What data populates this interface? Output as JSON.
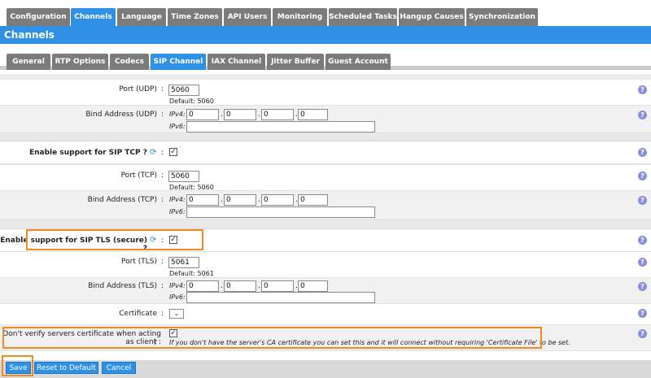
{
  "top_tabs": [
    {
      "label": "Configuration"
    },
    {
      "label": "Channels"
    },
    {
      "label": "Language"
    },
    {
      "label": "Time Zones"
    },
    {
      "label": "API Users"
    },
    {
      "label": "Monitoring"
    },
    {
      "label": "Scheduled Tasks"
    },
    {
      "label": "Hangup Causes"
    },
    {
      "label": "Synchronization"
    }
  ],
  "section_title": "Channels",
  "sub_tabs": [
    {
      "label": "General"
    },
    {
      "label": "RTP Options"
    },
    {
      "label": "Codecs"
    },
    {
      "label": "SIP Channel"
    },
    {
      "label": "IAX Channel"
    },
    {
      "label": "Jitter Buffer"
    },
    {
      "label": "Guest Account"
    }
  ],
  "common": {
    "colon": ":",
    "ipv4": "IPv4:",
    "ipv6": "IPv6:",
    "dot": ".",
    "check": "✓",
    "help": "?",
    "refresh": "⟳",
    "chevron": "⌄"
  },
  "udp": {
    "port_label": "Port (UDP)",
    "port_value": "5060",
    "port_default": "Default: 5060",
    "bind_label": "Bind Address (UDP)",
    "ipv4": [
      "0",
      "0",
      "0",
      "0"
    ],
    "ipv6": ""
  },
  "tcp": {
    "enable_label": "Enable support for SIP TCP ?",
    "port_label": "Port (TCP)",
    "port_value": "5060",
    "port_default": "Default: 5060",
    "bind_label": "Bind Address (TCP)",
    "ipv4": [
      "0",
      "0",
      "0",
      "0"
    ],
    "ipv6": ""
  },
  "tls": {
    "enable_label": "Enable support for SIP TLS (secure) ?",
    "port_label": "Port (TLS)",
    "port_value": "5061",
    "port_default": "Default: 5061",
    "bind_label": "Bind Address (TLS)",
    "ipv4": [
      "0",
      "0",
      "0",
      "0"
    ],
    "ipv6": "",
    "certificate_label": "Certificate",
    "verify_label": "Don't verify servers certificate when acting as client :",
    "verify_label_q": "?",
    "verify_hint": "If you don't have the server's CA certificate you can set this and it will connect without requiring 'Certificate File' to be set."
  },
  "buttons": {
    "save": "Save",
    "reset": "Reset to Default",
    "cancel": "Cancel"
  },
  "colors": {
    "accent": "#2f91e6",
    "tab_inactive": "#7b7b7b",
    "highlight": "#f08a24"
  }
}
